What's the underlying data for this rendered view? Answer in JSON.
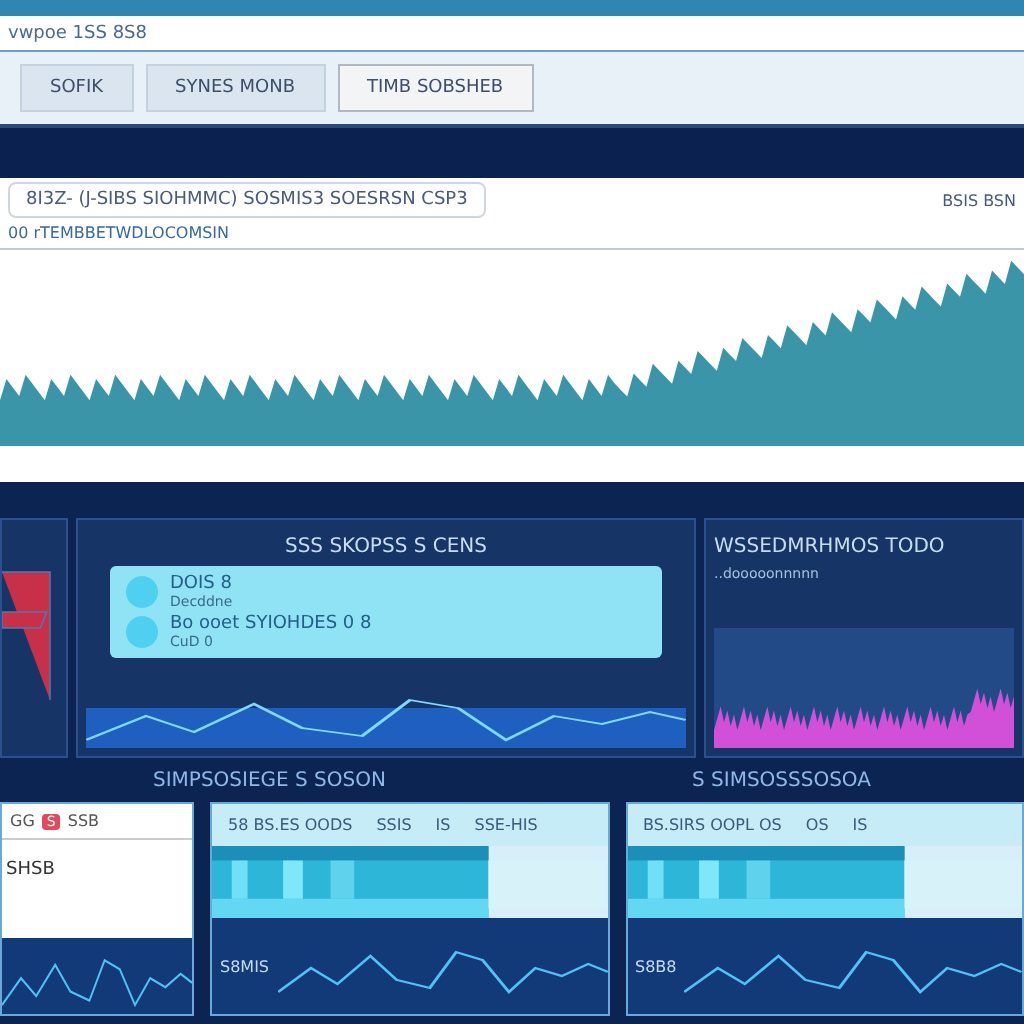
{
  "address_bar": {
    "text": "vwpoe 1SS 8S8"
  },
  "toolbar": {
    "buttons": [
      {
        "label": "SOFIK",
        "selected": false
      },
      {
        "label": "SYNES MONB",
        "selected": false
      },
      {
        "label": "TIMB SOBSHEB",
        "selected": true
      }
    ]
  },
  "main_panel": {
    "search": {
      "value": "8I3Z- (J-SIBS SIOHMMC) SOSMIS3 SOESRSN CSP3"
    },
    "side_label": "BSIS BSN",
    "subtitle": "00 rTEMBBETWDLOCOMSIN"
  },
  "panels": [
    {
      "kind": "marker"
    },
    {
      "kind": "list",
      "title": "SSS SKOPSS S CENS",
      "items": [
        {
          "title": "DOIS 8",
          "detail": "Decddne"
        },
        {
          "title": "Bo ooet SYIOHDES 0 8",
          "detail": "CuD 0"
        }
      ]
    },
    {
      "kind": "magenta",
      "title": "WSSEDMRHMOS TODO",
      "subtitle": "..dooooonnnnn"
    }
  ],
  "captions": [
    "SIMPSOSIEGE S SOSON",
    "S SIMSOSSSOSOA"
  ],
  "cards": [
    {
      "kind": "plain",
      "top": "GG",
      "badge": "S",
      "tail": "SSB",
      "body": "SHSB"
    },
    {
      "kind": "bars",
      "cells": [
        "58 BS.ES OODS",
        "SSIS",
        "IS",
        "SSE-HIS"
      ],
      "label": "S8MIS"
    },
    {
      "kind": "bars",
      "cells": [
        "BS.SIRS OOPL OS",
        "OS",
        "IS"
      ],
      "label": "S8B8"
    }
  ]
}
